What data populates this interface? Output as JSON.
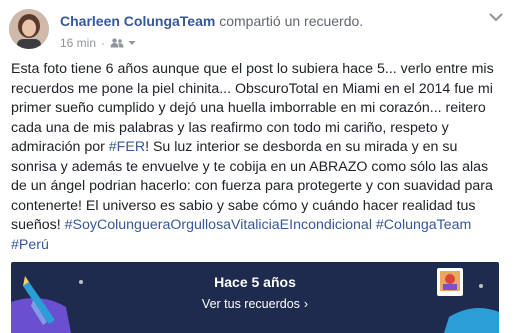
{
  "header": {
    "author": "Charleen ColungaTeam",
    "action": "compartió un recuerdo.",
    "time": "16 min",
    "separator": "·",
    "privacy_icon": "friends-icon",
    "menu_icon": "chevron-down-icon"
  },
  "post": {
    "text_part1": "Esta foto tiene 6 años aunque que el post lo subiera hace 5... verlo entre mis recuerdos me pone la piel chinita... ObscuroTotal en Miami en el 2014 fue mi primer sueño cumplido y dejó una huella imborrable en mi corazón... reitero cada una de mis palabras y las reafirmo con todo mi cariño, respeto y admiración por ",
    "hashtag_fer": "#FER",
    "text_part2": "! Su luz interior se desborda en su mirada y en su sonrisa y además te envuelve y te cobija en un ABRAZO como sólo las alas de un ángel podrian hacerlo: con fuerza para protegerte y con suavidad para contenerte! El universo es sabio y sabe cómo y cuándo hacer realidad tus sueños! ",
    "hashtag_1": "#SoyColungueraOrgullosaVitaliciaEIncondicional",
    "hashtag_2": "#ColungaTeam",
    "hashtag_3": "#Perú"
  },
  "memory": {
    "title": "Hace 5 años",
    "link": "Ver tus recuerdos",
    "arrow": "›",
    "colors": {
      "background": "#1f2a4f",
      "accent_purple": "#7b5bd6",
      "accent_blue": "#2a9fd6"
    }
  },
  "colors": {
    "link_blue": "#365899",
    "text": "#1d2129",
    "meta_gray": "#90949c"
  }
}
